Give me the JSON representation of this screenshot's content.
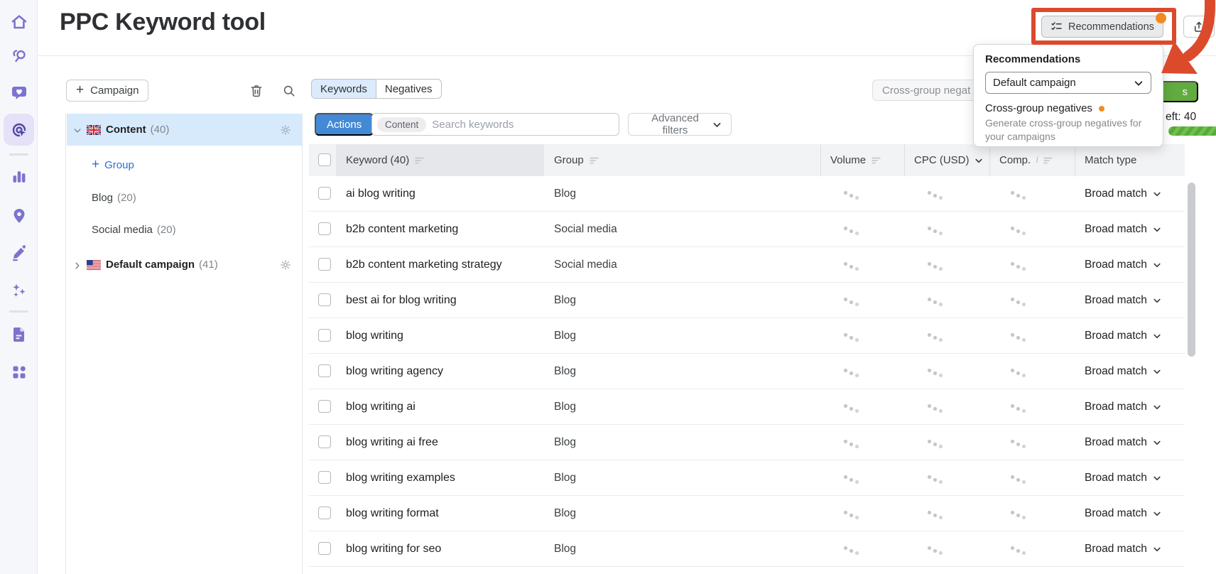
{
  "app_title": "PPC Keyword tool",
  "colors": {
    "accent_blue": "#4389d6",
    "link_blue": "#2a6fd6",
    "selected_row_blue": "#d7eafc",
    "active_tab_blue": "#dcebfb",
    "green_button": "#61ab3f",
    "annotation_red": "#dc4a2c",
    "notification_orange": "#f18b21",
    "sidebar_purple": "#7c73d0"
  },
  "sidebar": {
    "icons": [
      "home-icon",
      "keyword-research-icon",
      "engagement-icon",
      "ppc-tool-icon",
      "analytics-icon",
      "local-marketing-icon",
      "content-editor-icon",
      "ai-sparkles-icon",
      "reports-icon",
      "apps-icon"
    ],
    "active_icon": "ppc-tool-icon"
  },
  "header": {
    "recommendations_label": "Recommendations",
    "share_icon": "export-share-icon"
  },
  "popover": {
    "title": "Recommendations",
    "select_value": "Default campaign",
    "item_title": "Cross-group negatives",
    "item_desc": "Generate cross-group negatives for your campaigns"
  },
  "left_panel": {
    "campaign_button": "Campaign",
    "tree": [
      {
        "label": "Content",
        "count": "(40)",
        "flag": "uk",
        "state": "expanded",
        "selected": true
      },
      {
        "label": "Group",
        "type": "add-group-link"
      },
      {
        "label": "Blog",
        "count": "(20)"
      },
      {
        "label": "Social media",
        "count": "(20)"
      },
      {
        "label": "Default campaign",
        "count": "(41)",
        "flag": "us",
        "state": "collapsed"
      }
    ]
  },
  "toolbar": {
    "tabs": [
      {
        "label": "Keywords",
        "active": true
      },
      {
        "label": "Negatives",
        "active": false
      }
    ],
    "cross_group_button_visible_text": "Cross-group negat",
    "green_button_visible_text": "s",
    "keywords_left_visible_text": "eft: 40",
    "actions_button": "Actions",
    "search_tag": "Content",
    "search_placeholder": "Search keywords",
    "advanced_filters_label": "Advanced filters"
  },
  "table": {
    "columns": [
      {
        "label": "Keyword (40)"
      },
      {
        "label": "Group"
      },
      {
        "label": "Volume"
      },
      {
        "label": "CPC (USD)"
      },
      {
        "label": "Comp."
      },
      {
        "label": "Match type"
      }
    ],
    "rows": [
      {
        "keyword": "ai blog writing",
        "group": "Blog",
        "volume": "loading",
        "cpc": "loading",
        "comp": "loading",
        "match_type": "Broad match"
      },
      {
        "keyword": "b2b content marketing",
        "group": "Social media",
        "volume": "loading",
        "cpc": "loading",
        "comp": "loading",
        "match_type": "Broad match"
      },
      {
        "keyword": "b2b content marketing strategy",
        "group": "Social media",
        "volume": "loading",
        "cpc": "loading",
        "comp": "loading",
        "match_type": "Broad match"
      },
      {
        "keyword": "best ai for blog writing",
        "group": "Blog",
        "volume": "loading",
        "cpc": "loading",
        "comp": "loading",
        "match_type": "Broad match"
      },
      {
        "keyword": "blog writing",
        "group": "Blog",
        "volume": "loading",
        "cpc": "loading",
        "comp": "loading",
        "match_type": "Broad match"
      },
      {
        "keyword": "blog writing agency",
        "group": "Blog",
        "volume": "loading",
        "cpc": "loading",
        "comp": "loading",
        "match_type": "Broad match"
      },
      {
        "keyword": "blog writing ai",
        "group": "Blog",
        "volume": "loading",
        "cpc": "loading",
        "comp": "loading",
        "match_type": "Broad match"
      },
      {
        "keyword": "blog writing ai free",
        "group": "Blog",
        "volume": "loading",
        "cpc": "loading",
        "comp": "loading",
        "match_type": "Broad match"
      },
      {
        "keyword": "blog writing examples",
        "group": "Blog",
        "volume": "loading",
        "cpc": "loading",
        "comp": "loading",
        "match_type": "Broad match"
      },
      {
        "keyword": "blog writing format",
        "group": "Blog",
        "volume": "loading",
        "cpc": "loading",
        "comp": "loading",
        "match_type": "Broad match"
      },
      {
        "keyword": "blog writing for seo",
        "group": "Blog",
        "volume": "loading",
        "cpc": "loading",
        "comp": "loading",
        "match_type": "Broad match"
      }
    ]
  }
}
